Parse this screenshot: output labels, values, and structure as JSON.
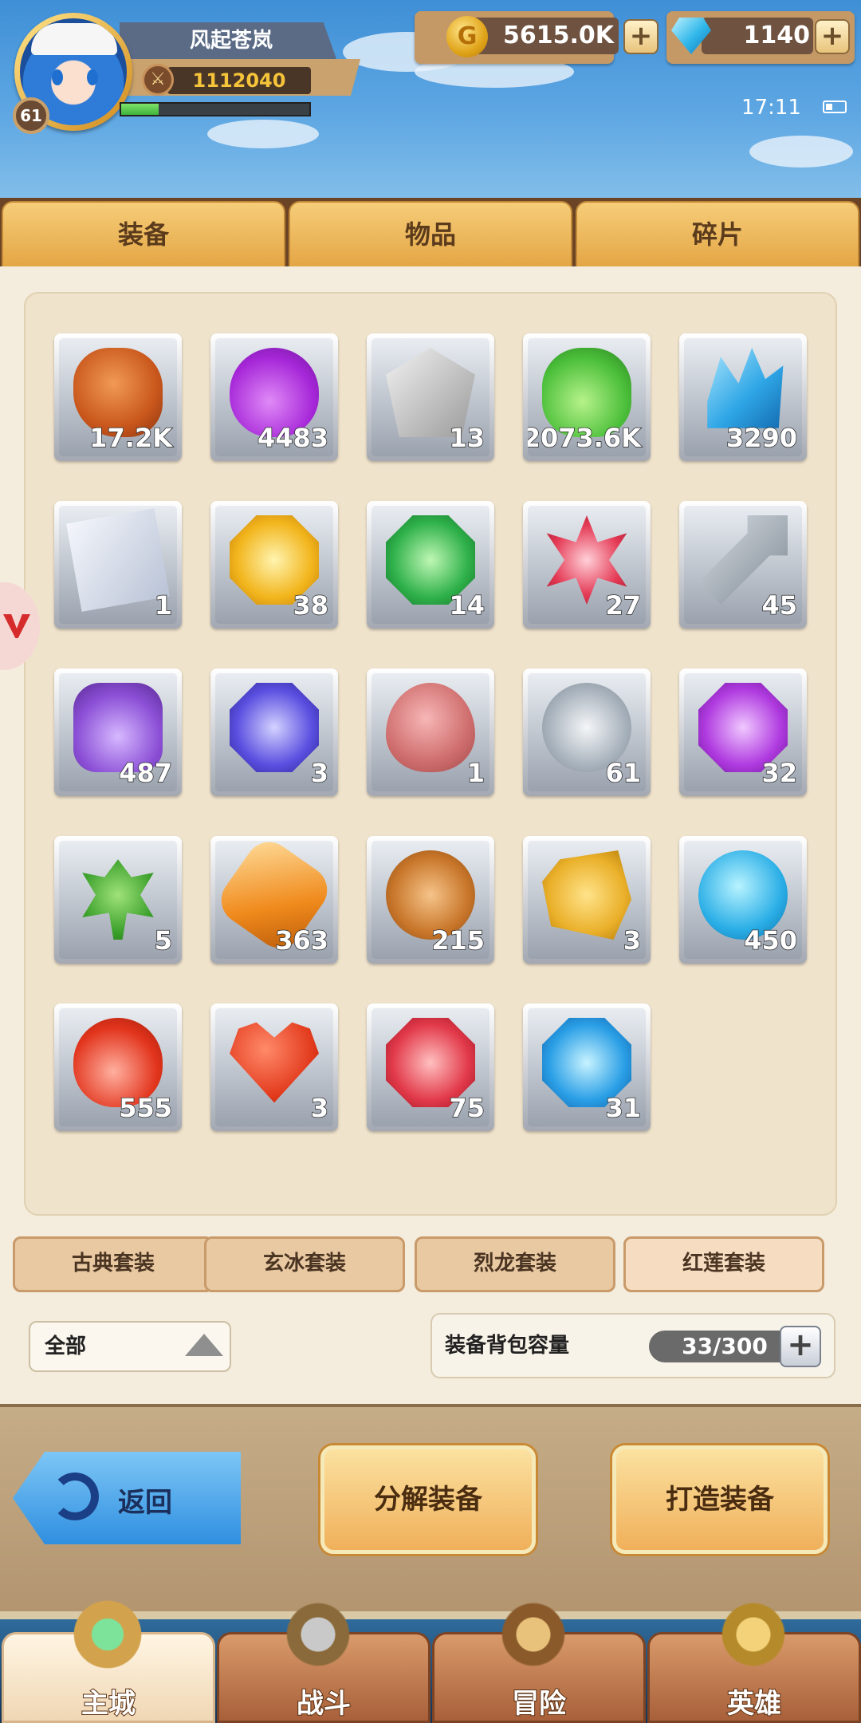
{
  "player": {
    "name": "风起苍岚",
    "level": "61",
    "power": "1112040",
    "exp_fraction": 0.2
  },
  "currency": {
    "gold": "5615.0K",
    "diamonds": "1140"
  },
  "status": {
    "time": "17:11"
  },
  "tabs": [
    {
      "label": "装备",
      "active": false
    },
    {
      "label": "物品",
      "active": true
    },
    {
      "label": "碎片",
      "active": false
    }
  ],
  "items": [
    {
      "icon": "rune-stone-icon",
      "count": "17.2K"
    },
    {
      "icon": "purple-potion-icon",
      "count": "4483"
    },
    {
      "icon": "skull-emblem-icon",
      "count": "13"
    },
    {
      "icon": "green-potion-icon",
      "count": "2073.6K"
    },
    {
      "icon": "blue-crystal-icon",
      "count": "3290"
    },
    {
      "icon": "scroll-map-icon",
      "count": "1"
    },
    {
      "icon": "yellow-armor-gem-icon",
      "count": "38"
    },
    {
      "icon": "green-glove-gem-icon",
      "count": "14"
    },
    {
      "icon": "red-star-icon",
      "count": "27"
    },
    {
      "icon": "key-icon",
      "count": "45"
    },
    {
      "icon": "purple-jar-icon",
      "count": "487"
    },
    {
      "icon": "blue-boot-gem-icon",
      "count": "3"
    },
    {
      "icon": "egg-icon",
      "count": "1"
    },
    {
      "icon": "silver-coin-icon",
      "count": "61"
    },
    {
      "icon": "purple-helmet-gem-icon",
      "count": "32"
    },
    {
      "icon": "clover-icon",
      "count": "5"
    },
    {
      "icon": "orange-vial-icon",
      "count": "363"
    },
    {
      "icon": "bronze-coin-icon",
      "count": "215"
    },
    {
      "icon": "lightning-stone-icon",
      "count": "3"
    },
    {
      "icon": "blue-orb-icon",
      "count": "450"
    },
    {
      "icon": "red-potion-icon",
      "count": "555"
    },
    {
      "icon": "heart-icon",
      "count": "3"
    },
    {
      "icon": "red-sword-gem-icon",
      "count": "75"
    },
    {
      "icon": "blue-shield-gem-icon",
      "count": "31"
    }
  ],
  "sets": [
    "古典套装",
    "玄冰套装",
    "烈龙套装",
    "红莲套装"
  ],
  "filter": {
    "label": "全部"
  },
  "capacity": {
    "label": "装备背包容量",
    "value": "33/300"
  },
  "buttons": {
    "back": "返回",
    "decompose": "分解装备",
    "forge": "打造装备"
  },
  "nav": [
    {
      "label": "主城",
      "icon": "castle-icon"
    },
    {
      "label": "战斗",
      "icon": "crossed-swords-icon"
    },
    {
      "label": "冒险",
      "icon": "map-scroll-icon"
    },
    {
      "label": "英雄",
      "icon": "hero-crest-icon"
    }
  ],
  "colors": {
    "accent": "#e4a645",
    "panel": "#f4ecdc",
    "sky": "#4f9fe0"
  }
}
